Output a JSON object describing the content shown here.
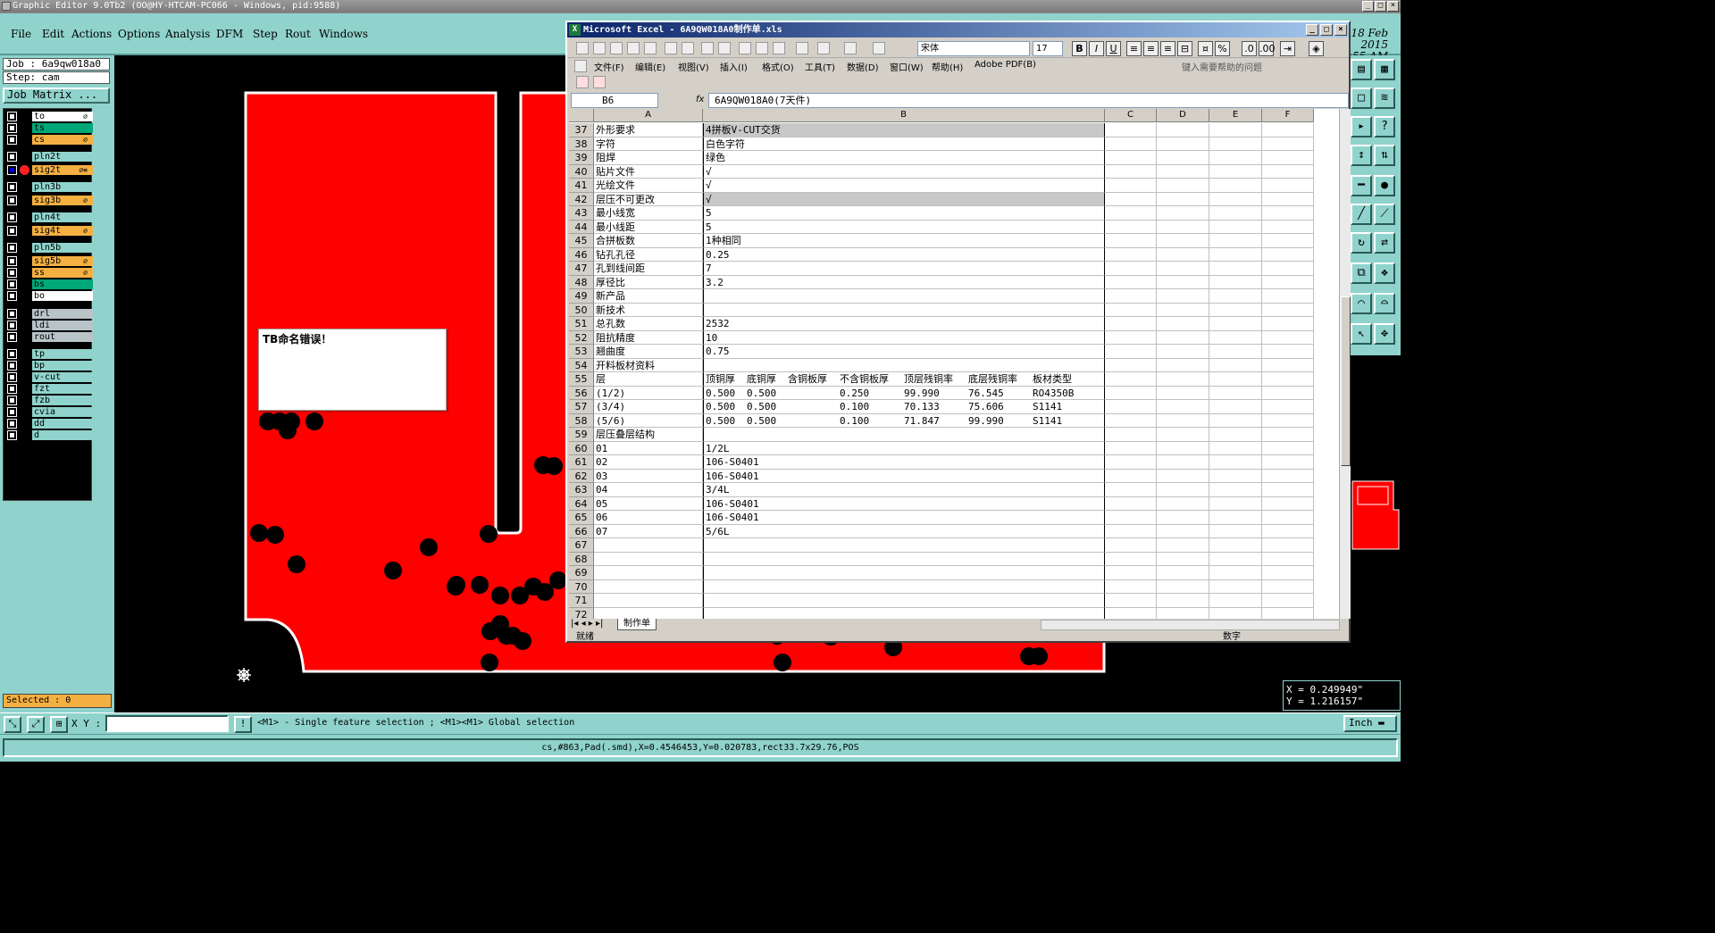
{
  "app": {
    "title": "Graphic Editor 9.0Tb2 (OO@HY-HTCAM-PC066 - Windows, pid:9588)",
    "menu": [
      "File",
      "Edit",
      "Actions",
      "Options",
      "Analysis",
      "DFM",
      "Step",
      "Rout",
      "Windows"
    ],
    "clock_line1": "Th  ay  2010 18 Feb 2015",
    "clock_line2": "10:55 AM"
  },
  "job": {
    "job_label": "Job : 6a9qw018a0",
    "step_label": "Step: cam",
    "matrix_button": "Job Matrix ..."
  },
  "layers": [
    {
      "name": "to",
      "color": "#ffffff",
      "mark": "⌀"
    },
    {
      "name": "ts",
      "color": "#00a878",
      "mark": ""
    },
    {
      "name": "cs",
      "color": "#f5b042",
      "mark": "⌀"
    },
    {
      "name": "pln2t",
      "color": "#8fd3cc",
      "mark": ""
    },
    {
      "name": "sig2t",
      "color": "#f5b042",
      "mark": "⌀≡",
      "active": true
    },
    {
      "name": "pln3b",
      "color": "#8fd3cc",
      "mark": ""
    },
    {
      "name": "sig3b",
      "color": "#f5b042",
      "mark": "⌀"
    },
    {
      "name": "pln4t",
      "color": "#8fd3cc",
      "mark": ""
    },
    {
      "name": "sig4t",
      "color": "#f5b042",
      "mark": "⌀"
    },
    {
      "name": "pln5b",
      "color": "#8fd3cc",
      "mark": ""
    },
    {
      "name": "sig5b",
      "color": "#f5b042",
      "mark": "⌀"
    },
    {
      "name": "ss",
      "color": "#f5b042",
      "mark": "⌀"
    },
    {
      "name": "bs",
      "color": "#00a878",
      "mark": ""
    },
    {
      "name": "bo",
      "color": "#ffffff",
      "mark": ""
    },
    {
      "name": "drl",
      "color": "#b8c4c8",
      "mark": ""
    },
    {
      "name": "ldi",
      "color": "#b8c4c8",
      "mark": ""
    },
    {
      "name": "rout",
      "color": "#b8c4c8",
      "mark": ""
    },
    {
      "name": "tp",
      "color": "#8fd3cc",
      "mark": ""
    },
    {
      "name": "bp",
      "color": "#8fd3cc",
      "mark": ""
    },
    {
      "name": "v-cut",
      "color": "#8fd3cc",
      "mark": ""
    },
    {
      "name": "fzt",
      "color": "#8fd3cc",
      "mark": ""
    },
    {
      "name": "fzb",
      "color": "#8fd3cc",
      "mark": ""
    },
    {
      "name": "cvia",
      "color": "#8fd3cc",
      "mark": ""
    },
    {
      "name": "dd",
      "color": "#8fd3cc",
      "mark": ""
    },
    {
      "name": "d",
      "color": "#8fd3cc",
      "mark": ""
    }
  ],
  "selected_label": "Selected : 0",
  "message_box": "TB命名错误！",
  "coords": {
    "x": "X = 0.249949\"",
    "y": "Y = 1.216157\""
  },
  "bottom": {
    "xy_label": "X Y :",
    "xy_value": "",
    "hint": "<M1> - Single feature selection ; <M1><M1> Global selection",
    "unit": "Inch",
    "hint_button": "!"
  },
  "status": "cs,#863,Pad(.smd),X=0.4546453,Y=0.020783,rect33.7x29.76,POS",
  "excel": {
    "title": "Microsoft Excel - 6A9QW018A0制作单.xls",
    "font": "宋体",
    "size": "17",
    "menu": [
      "文件(F)",
      "编辑(E)",
      "视图(V)",
      "插入(I)",
      "格式(O)",
      "工具(T)",
      "数据(D)",
      "窗口(W)",
      "帮助(H)",
      "Adobe PDF(B)"
    ],
    "help_placeholder": "键入需要帮助的问题",
    "namebox": "B6",
    "fx": "fx",
    "formula": "6A9QW018A0(7天件)",
    "columns": [
      "A",
      "B",
      "C",
      "D",
      "E",
      "F"
    ],
    "rows": [
      {
        "n": "37",
        "a": "外形要求",
        "b": "4拼板V-CUT交货",
        "sel": true
      },
      {
        "n": "38",
        "a": "字符",
        "b": "白色字符"
      },
      {
        "n": "39",
        "a": "阻焊",
        "b": "绿色"
      },
      {
        "n": "40",
        "a": "贴片文件",
        "b": "√"
      },
      {
        "n": "41",
        "a": "光绘文件",
        "b": "√"
      },
      {
        "n": "42",
        "a": "层压不可更改",
        "b": "√",
        "sel": true
      },
      {
        "n": "43",
        "a": "最小线宽",
        "b": "5"
      },
      {
        "n": "44",
        "a": "最小线距",
        "b": "5"
      },
      {
        "n": "45",
        "a": "合拼板数",
        "b": "1种相同"
      },
      {
        "n": "46",
        "a": "钻孔孔径",
        "b": "0.25"
      },
      {
        "n": "47",
        "a": "孔到线间距",
        "b": "7"
      },
      {
        "n": "48",
        "a": "厚径比",
        "b": "3.2"
      },
      {
        "n": "49",
        "a": "新产品",
        "b": ""
      },
      {
        "n": "50",
        "a": "新技术",
        "b": ""
      },
      {
        "n": "51",
        "a": "总孔数",
        "b": "2532"
      },
      {
        "n": "52",
        "a": "阻抗精度",
        "b": "10"
      },
      {
        "n": "53",
        "a": "翘曲度",
        "b": "0.75"
      },
      {
        "n": "54",
        "a": "开料板材资料",
        "b": ""
      },
      {
        "n": "55",
        "a": "层",
        "sub": [
          "顶铜厚",
          "底铜厚",
          "含铜板厚",
          "不含铜板厚",
          "顶层残铜率",
          "底层残铜率",
          "板材类型"
        ]
      },
      {
        "n": "56",
        "a": "(1/2)",
        "sub": [
          "0.500",
          "0.500",
          "",
          "0.250",
          "99.990",
          "76.545",
          "RO4350B"
        ]
      },
      {
        "n": "57",
        "a": "(3/4)",
        "sub": [
          "0.500",
          "0.500",
          "",
          "0.100",
          "70.133",
          "75.606",
          "S1141"
        ]
      },
      {
        "n": "58",
        "a": "(5/6)",
        "sub": [
          "0.500",
          "0.500",
          "",
          "0.100",
          "71.847",
          "99.990",
          "S1141"
        ]
      },
      {
        "n": "59",
        "a": "层压叠层结构",
        "b": ""
      },
      {
        "n": "60",
        "a": "01",
        "b": "1/2L"
      },
      {
        "n": "61",
        "a": "02",
        "b": "106-S0401"
      },
      {
        "n": "62",
        "a": "03",
        "b": "106-S0401"
      },
      {
        "n": "63",
        "a": "04",
        "b": "3/4L"
      },
      {
        "n": "64",
        "a": "05",
        "b": "106-S0401"
      },
      {
        "n": "65",
        "a": "06",
        "b": "106-S0401"
      },
      {
        "n": "66",
        "a": "07",
        "b": "5/6L"
      },
      {
        "n": "67",
        "a": "",
        "b": ""
      },
      {
        "n": "68",
        "a": "",
        "b": ""
      },
      {
        "n": "69",
        "a": "",
        "b": ""
      },
      {
        "n": "70",
        "a": "",
        "b": ""
      },
      {
        "n": "71",
        "a": "",
        "b": ""
      },
      {
        "n": "72",
        "a": "",
        "b": ""
      }
    ],
    "sheet_tab": "制作单",
    "status_left": "就绪",
    "status_right": "数字"
  },
  "colors": {
    "board_red": "#ff0000",
    "panel_teal": "#8fd3cc",
    "pad_black": "#000000"
  }
}
